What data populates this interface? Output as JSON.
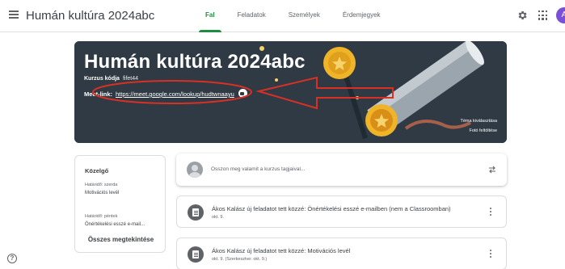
{
  "app": {
    "title": "Humán kultúra 2024abc"
  },
  "tabs": [
    {
      "label": "Fal",
      "active": true
    },
    {
      "label": "Feladatok",
      "active": false
    },
    {
      "label": "Személyek",
      "active": false
    },
    {
      "label": "Érdemjegyek",
      "active": false
    }
  ],
  "header_icons": [
    "menu-icon",
    "gear-icon",
    "apps-icon",
    "avatar"
  ],
  "avatar": {
    "initial": "A",
    "color": "#7b4fd6"
  },
  "banner": {
    "title": "Humán kultúra 2024abc",
    "code_label": "Kurzus kódja",
    "code_value": "fifet44",
    "meet_label": "Meet-link:",
    "meet_url": "https://meet.google.com/lookup/hudtwnaayu",
    "select_theme": "Téma kiválasztása",
    "upload_photo": "Fotó feltöltése",
    "annotation_color": "#d93025"
  },
  "upcoming": {
    "title": "Közelgő",
    "items": [
      {
        "due": "Határidő: szerda",
        "name": "Motivációs levél"
      },
      {
        "due": "Határidő: péntek",
        "name": "Önértékelési esszé e-mail..."
      }
    ],
    "view_all": "Összes megtekintése"
  },
  "stream": {
    "placeholder": "Osszon meg valamit a kurzus tagjaival...",
    "items": [
      {
        "title": "Ákos Kalász új feladatot tett közzé: Önértékelési esszé e-mailben (nem a Classroomban)",
        "date": "okt. 9."
      },
      {
        "title": "Ákos Kalász új feladatot tett közzé: Motivációs levél",
        "date": "okt. 9. (Szerkesztve: okt. 9.)"
      }
    ]
  },
  "colors": {
    "accent": "#1e8e3e",
    "banner_bg": "#2f3a44"
  }
}
